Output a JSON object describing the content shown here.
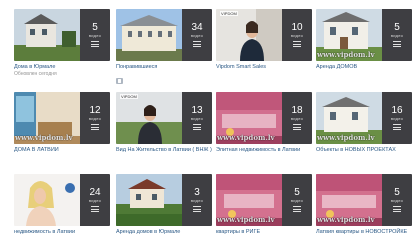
{
  "albums": [
    {
      "title": "Дома в Юрмале",
      "subtitle": "Обновлен сегодня",
      "count": "5",
      "count_label": "видео",
      "watermark": ""
    },
    {
      "title": "Понравившиеся",
      "subtitle": "",
      "count": "34",
      "count_label": "видео",
      "watermark": ""
    },
    {
      "title": "Vipdom Smart Sales",
      "subtitle": "",
      "count": "10",
      "count_label": "видео",
      "watermark": "",
      "logo": "VIPDOM"
    },
    {
      "title": "Аренда ДОМОВ",
      "subtitle": "",
      "count": "5",
      "count_label": "видео",
      "watermark": "www.vipdom.lv"
    },
    {
      "title": "ДОМА В ЛАТВИИ",
      "subtitle": "",
      "count": "12",
      "count_label": "видео",
      "watermark": "www.vipdom.lv"
    },
    {
      "title": "Вид На Жительство в Латвии ( ВНЖ )",
      "subtitle": "",
      "count": "13",
      "count_label": "видео",
      "watermark": "",
      "logo": "VIPDOM"
    },
    {
      "title": "Элитная недвижимость в Латвии",
      "subtitle": "",
      "count": "18",
      "count_label": "видео",
      "watermark": "www.vipdom.lv"
    },
    {
      "title": "Объекты в НОВЫХ ПРОЕКТАХ",
      "subtitle": "",
      "count": "16",
      "count_label": "видео",
      "watermark": "www.vipdom.lv"
    },
    {
      "title": "недвижимость в Латвии",
      "subtitle": "",
      "count": "24",
      "count_label": "видео",
      "watermark": ""
    },
    {
      "title": "Аренда домов в Юрмале",
      "subtitle": "",
      "count": "3",
      "count_label": "видео",
      "watermark": ""
    },
    {
      "title": "квартиры в РИГЕ",
      "subtitle": "",
      "count": "5",
      "count_label": "видео",
      "watermark": "www.vipdom.lv"
    },
    {
      "title": "Латвия квартиры в НОВОСТРОЙКЕ",
      "subtitle": "",
      "count": "5",
      "count_label": "видео",
      "watermark": "www.vipdom.lv"
    }
  ]
}
